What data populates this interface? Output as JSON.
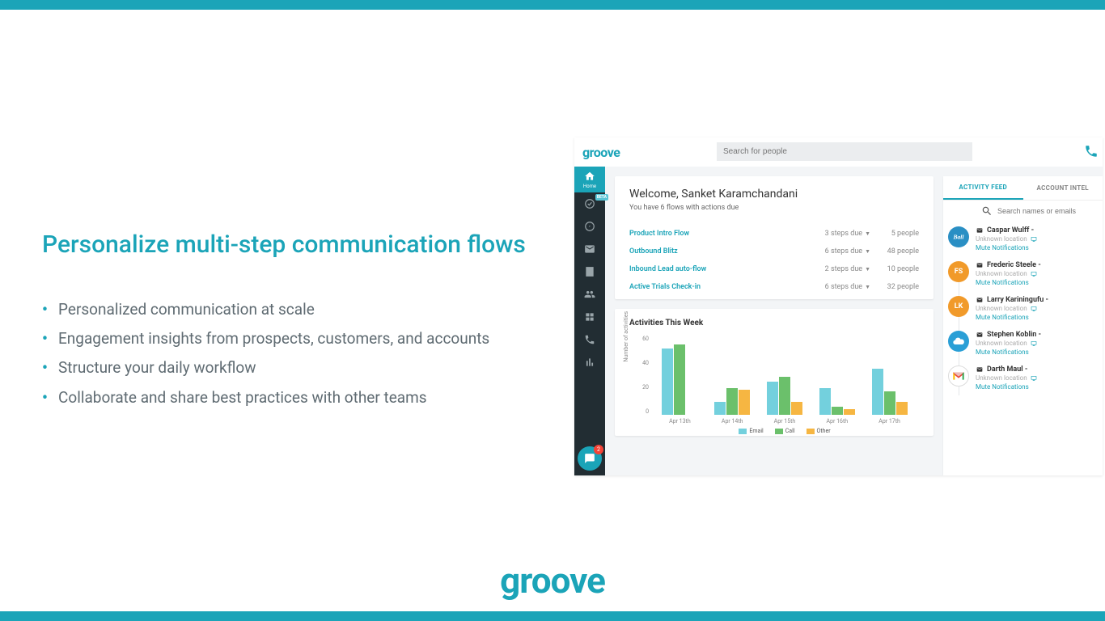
{
  "slide": {
    "heading": "Personalize multi-step communication flows",
    "bullets": [
      "Personalized communication at scale",
      "Engagement insights from prospects, customers, and accounts",
      "Structure your daily workflow",
      "Collaborate and share best practices with other teams"
    ],
    "bottom_logo": "groove"
  },
  "app": {
    "logo": "groove",
    "search_placeholder": "Search for people",
    "sidebar": {
      "home_label": "Home",
      "beta_badge": "BETA",
      "chat_badge": "2"
    },
    "welcome": {
      "title": "Welcome, Sanket Karamchandani",
      "subtitle": "You have 6 flows with actions due"
    },
    "flows": [
      {
        "name": "Product Intro Flow",
        "steps": "3 steps due",
        "people": "5 people"
      },
      {
        "name": "Outbound Blitz",
        "steps": "6 steps due",
        "people": "48 people"
      },
      {
        "name": "Inbound Lead auto-flow",
        "steps": "2 steps due",
        "people": "10 people"
      },
      {
        "name": "Active Trials Check-in",
        "steps": "6 steps due",
        "people": "32 people"
      }
    ],
    "activities_title": "Activities This Week",
    "tabs": {
      "feed": "ACTIVITY FEED",
      "intel": "ACCOUNT INTEL"
    },
    "feed_search_placeholder": "Search names or emails",
    "feed": [
      {
        "name": "Caspar Wulff -",
        "loc": "Unknown location",
        "mute": "Mute Notifications",
        "avatar_bg": "#2a8fc4",
        "avatar_text": "",
        "avatar_type": "ball"
      },
      {
        "name": "Frederic Steele -",
        "loc": "Unknown location",
        "mute": "Mute Notifications",
        "avatar_bg": "#f19a2a",
        "avatar_text": "FS",
        "avatar_type": "initials"
      },
      {
        "name": "Larry Kariningufu -",
        "loc": "Unknown location",
        "mute": "Mute Notifications",
        "avatar_bg": "#f19a2a",
        "avatar_text": "LK",
        "avatar_type": "initials"
      },
      {
        "name": "Stephen Koblin -",
        "loc": "Unknown location",
        "mute": "Mute Notifications",
        "avatar_bg": "#2a9fd6",
        "avatar_text": "",
        "avatar_type": "cloud"
      },
      {
        "name": "Darth Maul -",
        "loc": "Unknown location",
        "mute": "Mute Notifications",
        "avatar_bg": "#ffffff",
        "avatar_text": "",
        "avatar_type": "gmail"
      }
    ]
  },
  "chart_data": {
    "type": "bar",
    "title": "Activities This Week",
    "xlabel": "",
    "ylabel": "Number of activities",
    "ylim": [
      0,
      60
    ],
    "yticks": [
      60,
      40,
      20,
      0
    ],
    "categories": [
      "Apr 13th",
      "Apr 14th",
      "Apr 15th",
      "Apr 16th",
      "Apr 17th"
    ],
    "series": [
      {
        "name": "Email",
        "color": "#73d0dd",
        "values": [
          50,
          10,
          25,
          20,
          35
        ]
      },
      {
        "name": "Call",
        "color": "#6bc06b",
        "values": [
          53,
          20,
          29,
          6,
          18
        ]
      },
      {
        "name": "Other",
        "color": "#f6b642",
        "values": [
          0,
          19,
          10,
          4,
          10
        ]
      }
    ]
  }
}
